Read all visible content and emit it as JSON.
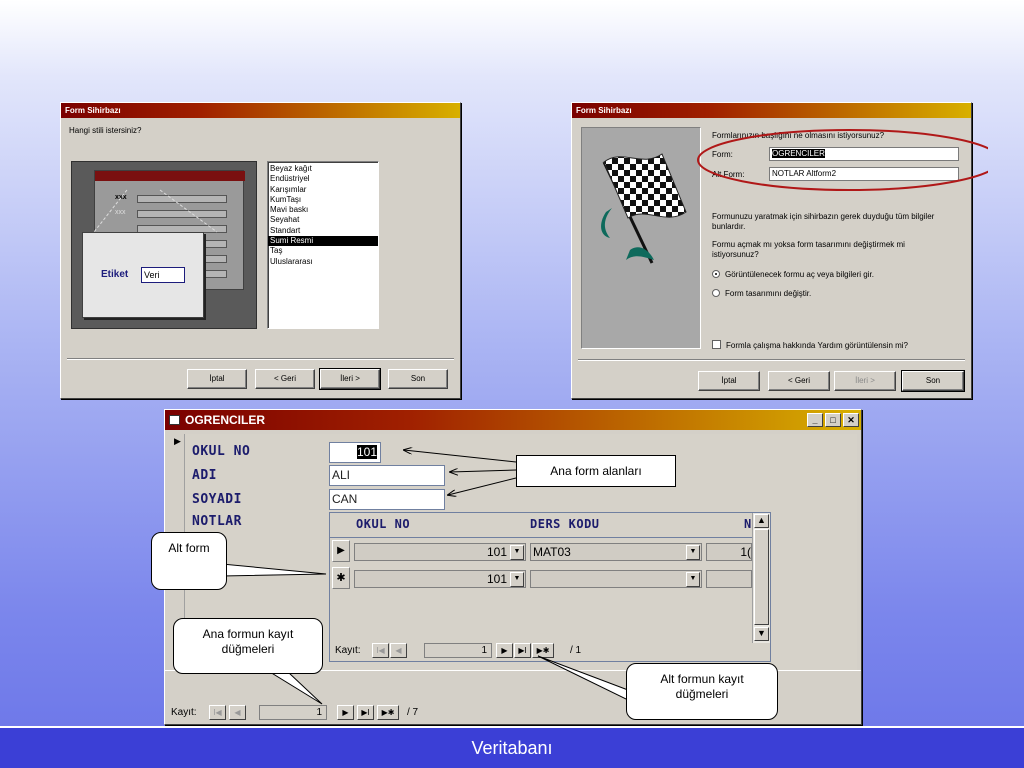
{
  "wizard1": {
    "title": "Form Sihirbazı",
    "question": "Hangi stili istersiniz?",
    "preview": {
      "mark": "xxx",
      "label": "Etiket",
      "value": "Veri"
    },
    "styles": [
      "Beyaz kağıt",
      "Endüstriyel",
      "Karışımlar",
      "KumTaşı",
      "Mavi baskı",
      "Seyahat",
      "Standart",
      "Sumi Resmi",
      "Taş",
      "Uluslararası"
    ],
    "selected_style": "Sumi Resmi",
    "buttons": {
      "cancel": "İptal",
      "back": "< Geri",
      "next": "İleri >",
      "finish": "Son"
    }
  },
  "wizard2": {
    "title": "Form Sihirbazı",
    "question": "Formlarınızın başlığını ne olmasını istiyorsunuz?",
    "form_label": "Form:",
    "form_value": "OGRENCILER",
    "subform_label": "Alt Form:",
    "subform_value": "NOTLAR Altform2",
    "info1": "Formunuzu yaratmak için sihirbazın gerek duyduğu tüm bilgiler bunlardır.",
    "info2": "Formu açmak mı yoksa form tasarımını değiştirmek mi istiyorsunuz?",
    "option1": "Görüntülenecek formu aç veya bilgileri gir.",
    "option2": "Form tasarımını değiştir.",
    "help_check": "Formla çalışma hakkında Yardım görüntülensin mi?",
    "buttons": {
      "cancel": "İptal",
      "back": "< Geri",
      "next": "İleri >",
      "finish": "Son"
    }
  },
  "main_form": {
    "title": "OGRENCILER",
    "fields": [
      {
        "label": "OKUL NO",
        "value": "101"
      },
      {
        "label": "ADI",
        "value": "ALI"
      },
      {
        "label": "SOYADI",
        "value": "CAN"
      },
      {
        "label": "NOTLAR",
        "value": ""
      }
    ],
    "subform": {
      "columns": [
        "OKUL NO",
        "DERS KODU",
        "N"
      ],
      "rows": [
        {
          "okul_no": "101",
          "ders_kodu": "MAT03",
          "extra": "1("
        },
        {
          "okul_no": "101",
          "ders_kodu": "",
          "extra": ""
        }
      ],
      "record_label": "Kayıt:",
      "record_current": "1",
      "record_total": "/ 1"
    },
    "record_label": "Kayıt:",
    "record_current": "1",
    "record_total": "/ 7"
  },
  "callouts": {
    "main_fields": "Ana form alanları",
    "subform": "Alt form",
    "main_nav": "Ana formun kayıt düğmeleri",
    "sub_nav": "Alt formun kayıt düğmeleri"
  },
  "footer": {
    "title": "Veritabanı"
  },
  "colors": {
    "title_start": "#7a0000",
    "title_end": "#d8b000",
    "footer": "#3b3fd6",
    "highlight_ellipse": "#b01818"
  }
}
